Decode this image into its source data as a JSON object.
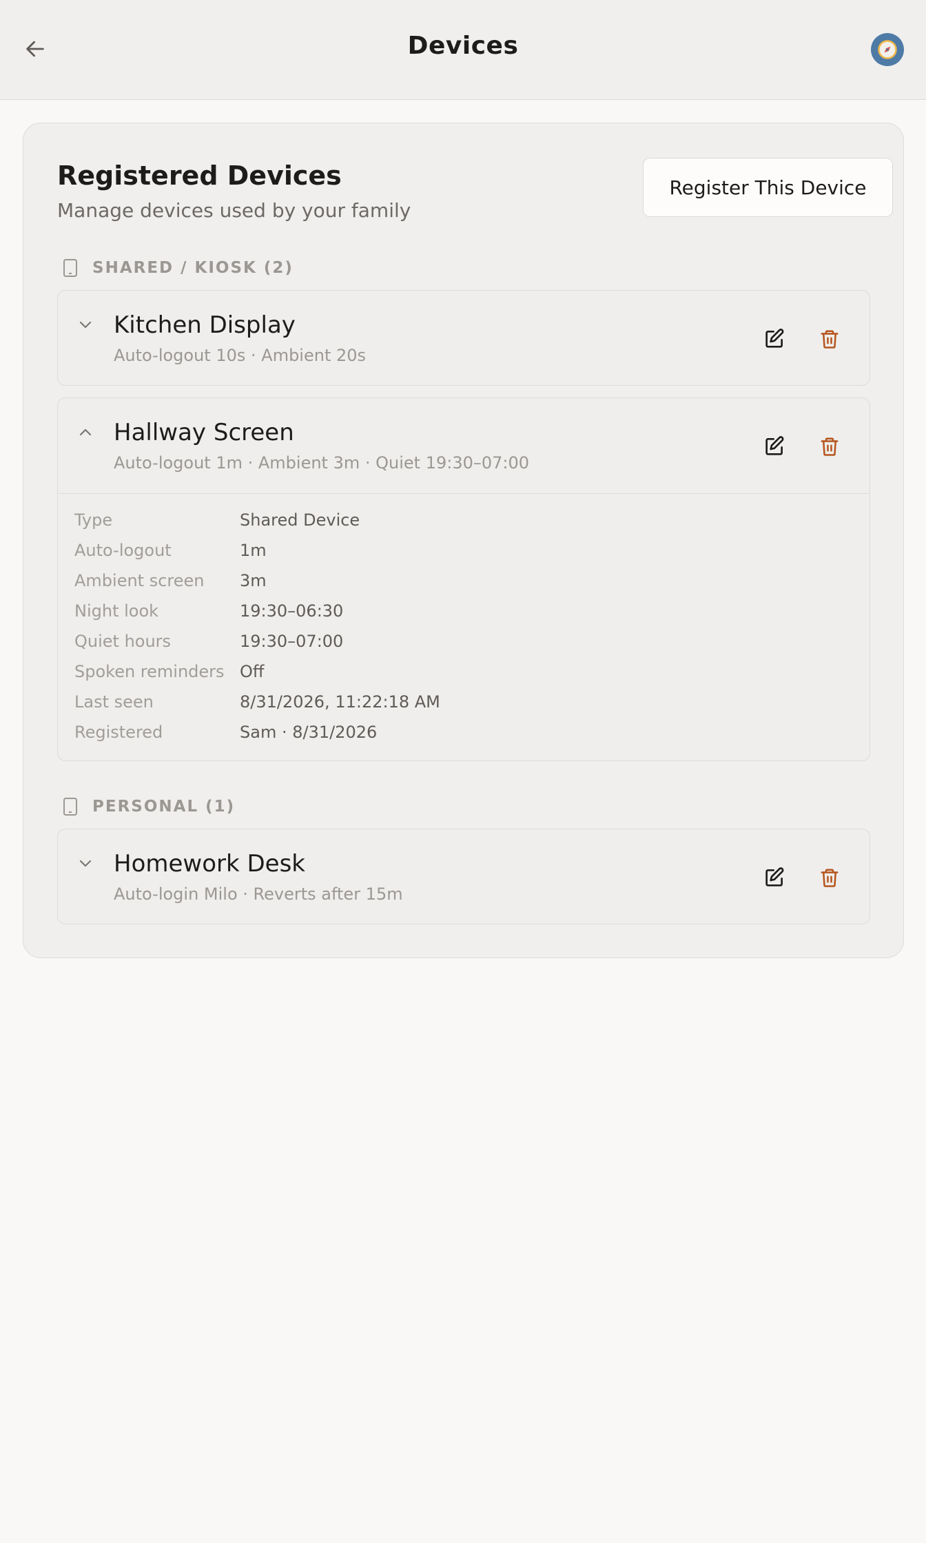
{
  "header": {
    "title": "Devices"
  },
  "panel": {
    "title": "Registered Devices",
    "subtitle": "Manage devices used by your family",
    "register_label": "Register This Device"
  },
  "sections": [
    {
      "label": "SHARED / KIOSK (2)",
      "devices": [
        {
          "name": "Kitchen Display",
          "summary": "Auto-logout 10s · Ambient 20s",
          "expanded": false
        },
        {
          "name": "Hallway Screen",
          "summary": "Auto-logout 1m · Ambient 3m · Quiet 19:30–07:00",
          "expanded": true,
          "details": [
            {
              "key": "Type",
              "value": "Shared Device"
            },
            {
              "key": "Auto-logout",
              "value": "1m"
            },
            {
              "key": "Ambient screen",
              "value": "3m"
            },
            {
              "key": "Night look",
              "value": "19:30–06:30"
            },
            {
              "key": "Quiet hours",
              "value": "19:30–07:00"
            },
            {
              "key": "Spoken reminders",
              "value": "Off"
            },
            {
              "key": "Last seen",
              "value": "8/31/2026, 11:22:18 AM"
            },
            {
              "key": "Registered",
              "value": "Sam · 8/31/2026"
            }
          ]
        }
      ]
    },
    {
      "label": "PERSONAL (1)",
      "devices": [
        {
          "name": "Homework Desk",
          "summary": "Auto-login Milo · Reverts after 15m",
          "expanded": false
        }
      ]
    }
  ],
  "colors": {
    "delete": "#b5541c",
    "avatar": "#4e7ba6",
    "avatar_glyph": "#f2b84b"
  },
  "icons": {
    "back": "arrow-left-icon",
    "avatar": "compass-icon",
    "section": "tablet-icon",
    "collapsed": "chevron-down-icon",
    "expanded": "chevron-up-icon",
    "edit": "edit-icon",
    "delete": "trash-icon"
  }
}
